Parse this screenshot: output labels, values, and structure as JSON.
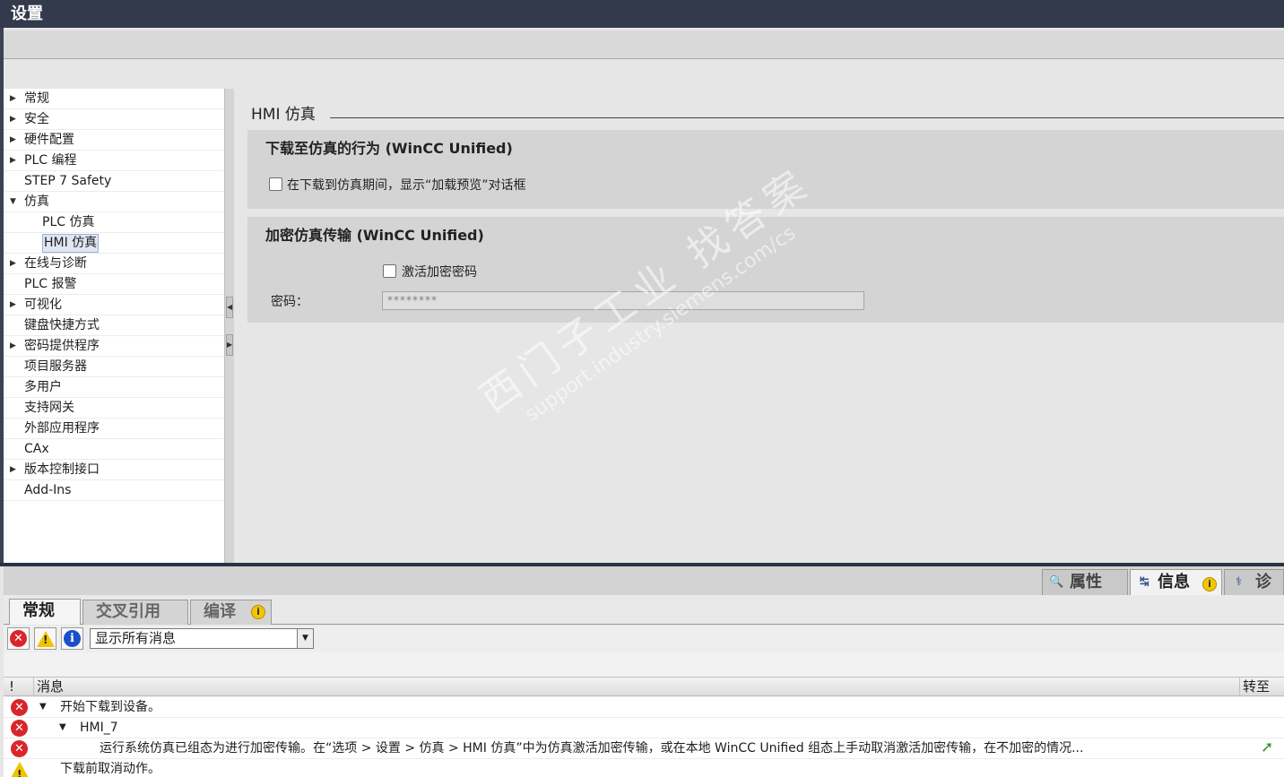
{
  "window": {
    "title": "设置"
  },
  "tree": {
    "items": [
      {
        "label": "常规",
        "arrow": "▶",
        "level": 0
      },
      {
        "label": "安全",
        "arrow": "▶",
        "level": 0
      },
      {
        "label": "硬件配置",
        "arrow": "▶",
        "level": 0
      },
      {
        "label": "PLC 编程",
        "arrow": "▶",
        "level": 0
      },
      {
        "label": "STEP 7 Safety",
        "arrow": "",
        "level": 0
      },
      {
        "label": "仿真",
        "arrow": "▼",
        "level": 0
      },
      {
        "label": "PLC 仿真",
        "arrow": "",
        "level": 1
      },
      {
        "label": "HMI 仿真",
        "arrow": "",
        "level": 1,
        "selected": true
      },
      {
        "label": "在线与诊断",
        "arrow": "▶",
        "level": 0
      },
      {
        "label": "PLC 报警",
        "arrow": "",
        "level": 0
      },
      {
        "label": "可视化",
        "arrow": "▶",
        "level": 0
      },
      {
        "label": "键盘快捷方式",
        "arrow": "",
        "level": 0
      },
      {
        "label": "密码提供程序",
        "arrow": "▶",
        "level": 0
      },
      {
        "label": "项目服务器",
        "arrow": "",
        "level": 0
      },
      {
        "label": "多用户",
        "arrow": "",
        "level": 0
      },
      {
        "label": "支持网关",
        "arrow": "",
        "level": 0
      },
      {
        "label": "外部应用程序",
        "arrow": "",
        "level": 0
      },
      {
        "label": "CAx",
        "arrow": "",
        "level": 0
      },
      {
        "label": "版本控制接口",
        "arrow": "▶",
        "level": 0
      },
      {
        "label": "Add-Ins",
        "arrow": "",
        "level": 0
      }
    ]
  },
  "main": {
    "heading": "HMI 仿真",
    "section1": {
      "title": "下载至仿真的行为 (WinCC Unified)",
      "checkbox_label": "在下载到仿真期间，显示“加载预览”对话框",
      "checked": false
    },
    "section2": {
      "title": "加密仿真传输 (WinCC Unified)",
      "checkbox_label": "激活加密密码",
      "checked": false,
      "password_label": "密码：",
      "password_value": "********"
    }
  },
  "watermark": {
    "line1": "西门子工业  找答案",
    "line2": "support.industry.siemens.com/cs"
  },
  "inspector": {
    "tabs": [
      {
        "label": "属性",
        "icon": "properties-icon"
      },
      {
        "label": "信息",
        "icon": "info-tab-icon",
        "active": true
      },
      {
        "label": "诊断",
        "icon": "diagnostics-icon"
      }
    ]
  },
  "subtabs": [
    {
      "label": "常规",
      "active": true
    },
    {
      "label": "交叉引用"
    },
    {
      "label": "编译"
    }
  ],
  "filter": {
    "selected": "显示所有消息"
  },
  "messages": {
    "columns": {
      "severity": "!",
      "message": "消息",
      "goto": "转至"
    },
    "rows": [
      {
        "severity": "error",
        "text": "开始下载到设备。"
      },
      {
        "severity": "error",
        "text": "HMI_7"
      },
      {
        "severity": "error",
        "text": "运行系统仿真已组态为进行加密传输。在“选项 > 设置 > 仿真 > HMI 仿真”中为仿真激活加密传输，或在本地 WinCC Unified 组态上手动取消激活加密传输，在不加密的情况..."
      },
      {
        "severity": "warning",
        "text": "下载前取消动作。"
      }
    ]
  },
  "colors": {
    "title_bar": "#323a4c",
    "error": "#d8262a",
    "warning": "#f2c400",
    "info": "#1a4fc9",
    "goto": "#2f9b2f"
  }
}
